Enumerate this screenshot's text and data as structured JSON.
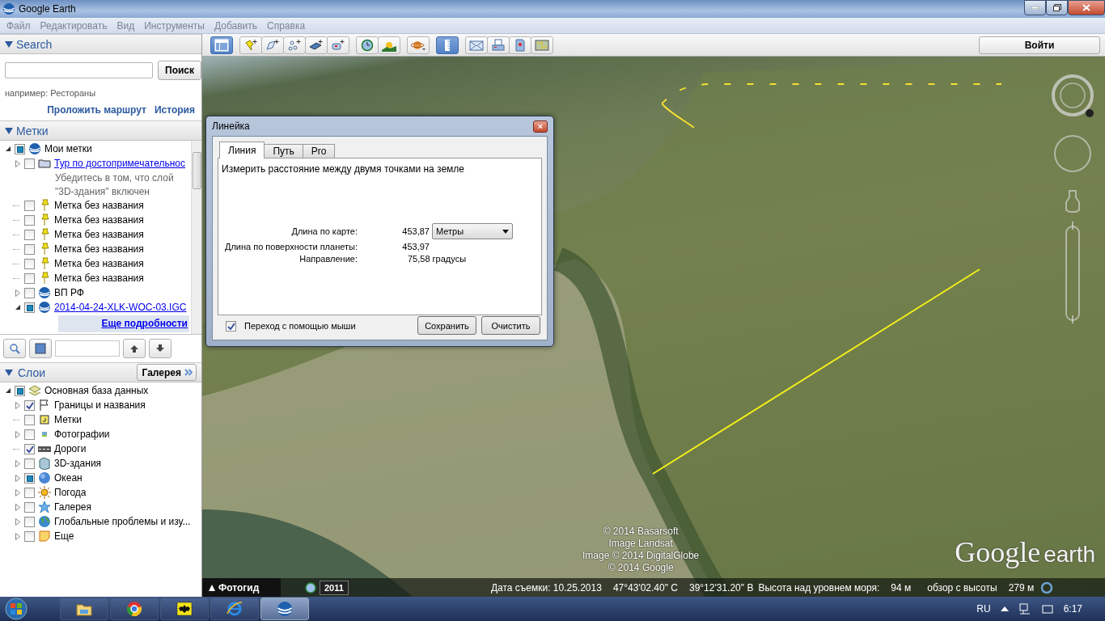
{
  "window": {
    "title": "Google Earth"
  },
  "menu": [
    "Файл",
    "Редактировать",
    "Вид",
    "Инструменты",
    "Добавить",
    "Справка"
  ],
  "search": {
    "title": "Search",
    "expanded": true,
    "button": "Поиск",
    "hint": "например: Рестораны",
    "links": [
      "Проложить маршрут",
      "История"
    ]
  },
  "places": {
    "title": "Метки",
    "expanded": true,
    "items": [
      {
        "label": "Мои метки",
        "kind": "globe",
        "checked": false,
        "mixed": true,
        "expanded": true,
        "children": [
          {
            "label": "Тур по достопримечательнос",
            "kind": "folder",
            "link": true,
            "checked": false,
            "mixed": false,
            "expanded": false,
            "description": "Убедитесь в том, что слой \"3D-здания\" включен"
          },
          {
            "label": "Метка без названия",
            "kind": "pin",
            "link": false,
            "checked": false,
            "mixed": false
          },
          {
            "label": "Метка без названия",
            "kind": "pin",
            "link": false,
            "checked": false,
            "mixed": false
          },
          {
            "label": "Метка без названия",
            "kind": "pin",
            "link": false,
            "checked": false,
            "mixed": false
          },
          {
            "label": "Метка без названия",
            "kind": "pin",
            "link": false,
            "checked": false,
            "mixed": false
          },
          {
            "label": "Метка без названия",
            "kind": "pin",
            "link": false,
            "checked": false,
            "mixed": false
          },
          {
            "label": "Метка без названия",
            "kind": "pin",
            "link": false,
            "checked": false,
            "mixed": false
          },
          {
            "label": "ВП РФ",
            "kind": "globe",
            "link": false,
            "checked": false,
            "mixed": false,
            "expanded": false
          },
          {
            "label": "2014-04-24-XLK-WOC-03.IGC",
            "kind": "globe",
            "link": true,
            "checked": false,
            "mixed": true,
            "expanded": true,
            "more": "Еще подробности"
          }
        ]
      }
    ]
  },
  "layers": {
    "title": "Слои",
    "expanded": true,
    "gallery": "Галерея",
    "items": [
      {
        "label": "Основная база данных",
        "kind": "database",
        "checked": false,
        "mixed": true,
        "expanded": true,
        "children": [
          {
            "label": "Границы и названия",
            "kind": "flag",
            "checked": true,
            "mixed": false,
            "expanded": false
          },
          {
            "label": "Метки",
            "kind": "marker",
            "checked": false,
            "mixed": false
          },
          {
            "label": "Фотографии",
            "kind": "photo",
            "checked": false,
            "mixed": false,
            "expanded": false
          },
          {
            "label": "Дороги",
            "kind": "road",
            "checked": true,
            "mixed": false
          },
          {
            "label": "3D-здания",
            "kind": "building",
            "checked": false,
            "mixed": false,
            "expanded": false
          },
          {
            "label": "Океан",
            "kind": "ocean",
            "checked": false,
            "mixed": true,
            "expanded": false
          },
          {
            "label": "Погода",
            "kind": "weather",
            "checked": false,
            "mixed": false,
            "expanded": false
          },
          {
            "label": "Галерея",
            "kind": "star",
            "checked": false,
            "mixed": false,
            "expanded": false
          },
          {
            "label": "Глобальные проблемы и изу...",
            "kind": "earth",
            "checked": false,
            "mixed": false,
            "expanded": false
          },
          {
            "label": "Еще",
            "kind": "note",
            "checked": false,
            "mixed": false,
            "expanded": false
          }
        ]
      }
    ]
  },
  "toolbar": [
    [
      {
        "kind": "sidebar",
        "selected": true
      }
    ],
    [
      {
        "kind": "placemark",
        "selected": false
      },
      {
        "kind": "polygon",
        "selected": false
      },
      {
        "kind": "path",
        "selected": false
      },
      {
        "kind": "overlay",
        "selected": false
      },
      {
        "kind": "record",
        "selected": false
      }
    ],
    [
      {
        "kind": "history",
        "selected": false
      },
      {
        "kind": "sun",
        "selected": false
      }
    ],
    [
      {
        "kind": "planet",
        "selected": false
      }
    ],
    [
      {
        "kind": "ruler",
        "selected": true
      }
    ],
    [
      {
        "kind": "email",
        "selected": false
      },
      {
        "kind": "print",
        "selected": false
      },
      {
        "kind": "image",
        "selected": false
      },
      {
        "kind": "map",
        "selected": false
      }
    ]
  ],
  "sign_in": "Войти",
  "ruler": {
    "title": "Линейка",
    "close": "×",
    "tabs": [
      {
        "label": "Линия",
        "selected": true
      },
      {
        "label": "Путь",
        "selected": false
      },
      {
        "label": "Pro",
        "selected": false
      }
    ],
    "description": "Измерить расстояние между двумя точками на земле",
    "rows": [
      {
        "label": "Длина по карте:",
        "value": "453,87"
      },
      {
        "label": "Длина по поверхности планеты:",
        "value": "453,97"
      },
      {
        "label": "Направление:",
        "value": "75,58 градусы"
      }
    ],
    "unit": "Метры",
    "mouse_nav": {
      "label": "Переход с помощью мыши",
      "checked": true
    },
    "buttons": [
      "Сохранить",
      "Очистить"
    ]
  },
  "map": {
    "attribution": [
      "© 2014 Basarsoft",
      "Image Landsat",
      "Image © 2014 DigitalGlobe",
      "© 2014 Google"
    ],
    "logo": [
      "Google",
      "earth"
    ],
    "status": {
      "tour_guide": "Фотогид",
      "year": "2011",
      "date": "Дата съемки: 10.25.2013",
      "lat": "47°43'02.40\" С",
      "lon": "39°12'31.20\" В",
      "elev_label": "Высота над уровнем моря:",
      "elev": "94 м",
      "eye_label": "обзор с высоты",
      "eye": "279 м"
    }
  },
  "taskbar": {
    "apps": [
      {
        "kind": "folder",
        "selected": false
      },
      {
        "kind": "browser",
        "selected": false
      },
      {
        "kind": "bat",
        "selected": false
      },
      {
        "kind": "ie",
        "selected": false
      },
      {
        "kind": "earth",
        "selected": true
      }
    ],
    "lang": "RU",
    "time": "6:17"
  }
}
